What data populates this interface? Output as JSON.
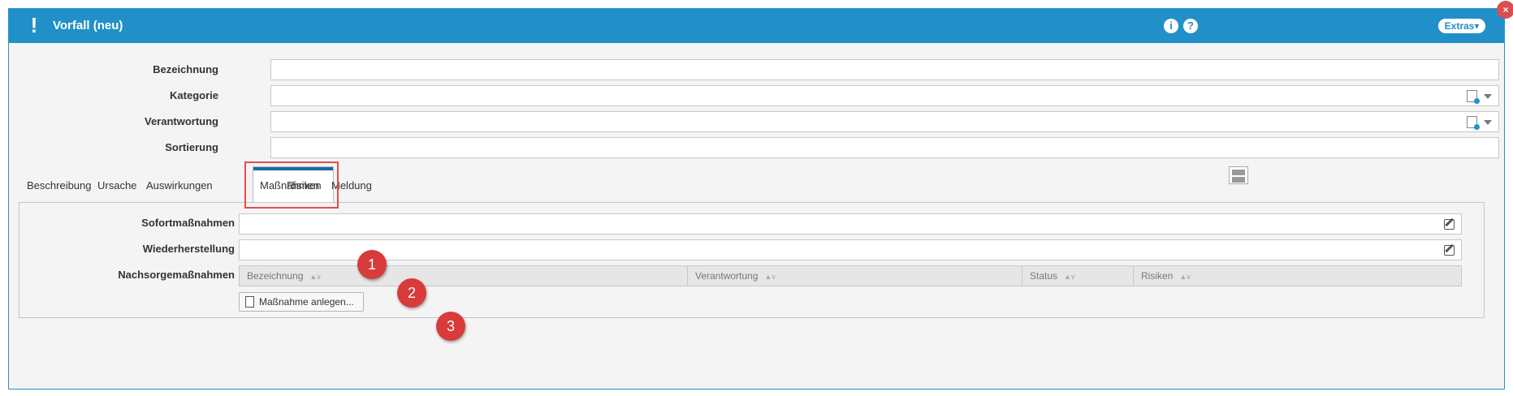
{
  "window": {
    "title": "Vorfall (neu)",
    "info_icon": "i",
    "help_icon": "?",
    "extras_label": "Extras▾",
    "close_icon": "×"
  },
  "form": {
    "fields": [
      {
        "label": "Bezeichnung",
        "value": "",
        "type": "text"
      },
      {
        "label": "Kategorie",
        "value": "",
        "type": "lookup"
      },
      {
        "label": "Verantwortung",
        "value": "",
        "type": "lookup"
      },
      {
        "label": "Sortierung",
        "value": "",
        "type": "text"
      }
    ]
  },
  "tabs": [
    {
      "label": "Beschreibung",
      "active": false
    },
    {
      "label": "Ursache",
      "active": false
    },
    {
      "label": "Auswirkungen",
      "active": false
    },
    {
      "label": "Maßnahmen",
      "active": true
    },
    {
      "label": "Risiken",
      "active": false
    },
    {
      "label": "Meldung",
      "active": false
    }
  ],
  "massnahmen": {
    "sofort_label": "Sofortmaßnahmen",
    "sofort_value": "",
    "wieder_label": "Wiederherstellung",
    "wieder_value": "",
    "nachsorge_label": "Nachsorgemaßnahmen",
    "grid_columns": [
      "Bezeichnung",
      "Verantwortung",
      "Status",
      "Risiken"
    ],
    "sort_indicator": "▲∨",
    "add_button_label": "Maßnahme anlegen..."
  },
  "markers": [
    "1",
    "2",
    "3"
  ],
  "colors": {
    "titlebar": "#2190c8",
    "highlight": "#e74c4c",
    "marker": "#d93a3a"
  }
}
